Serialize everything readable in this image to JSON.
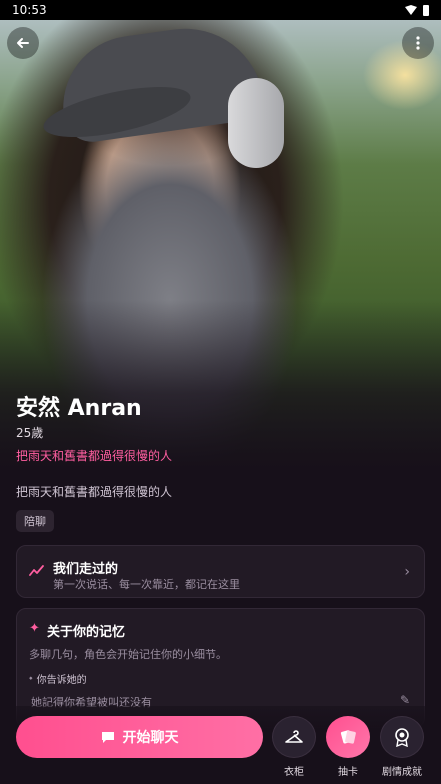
{
  "status_bar": {
    "time": "10:53"
  },
  "header": {
    "back_icon": "arrow-left-icon",
    "more_icon": "more-vertical-icon"
  },
  "profile": {
    "name": "安然 Anran",
    "age": "25歲",
    "tagline": "把雨天和舊書都過得很慢的人",
    "description": "把雨天和舊書都過得很慢的人",
    "tag": "陪聊"
  },
  "journey_card": {
    "title": "我们走过的",
    "subtitle": "第一次说话、每一次靠近，都记在这里"
  },
  "memory_card": {
    "title": "关于你的记忆",
    "subtitle": "多聊几句，角色会开始记住你的小细节。",
    "section_label": "你告诉她的",
    "value": "她記得你希望被叫还没有"
  },
  "bottom": {
    "chat_label": "开始聊天",
    "actions": [
      {
        "label": "衣柜",
        "icon": "hanger-icon"
      },
      {
        "label": "抽卡",
        "icon": "cards-icon"
      },
      {
        "label": "剧情成就",
        "icon": "badge-icon"
      }
    ]
  },
  "colors": {
    "accent": "#ff5ea0",
    "background": "#17101a",
    "card": "#221a25"
  }
}
